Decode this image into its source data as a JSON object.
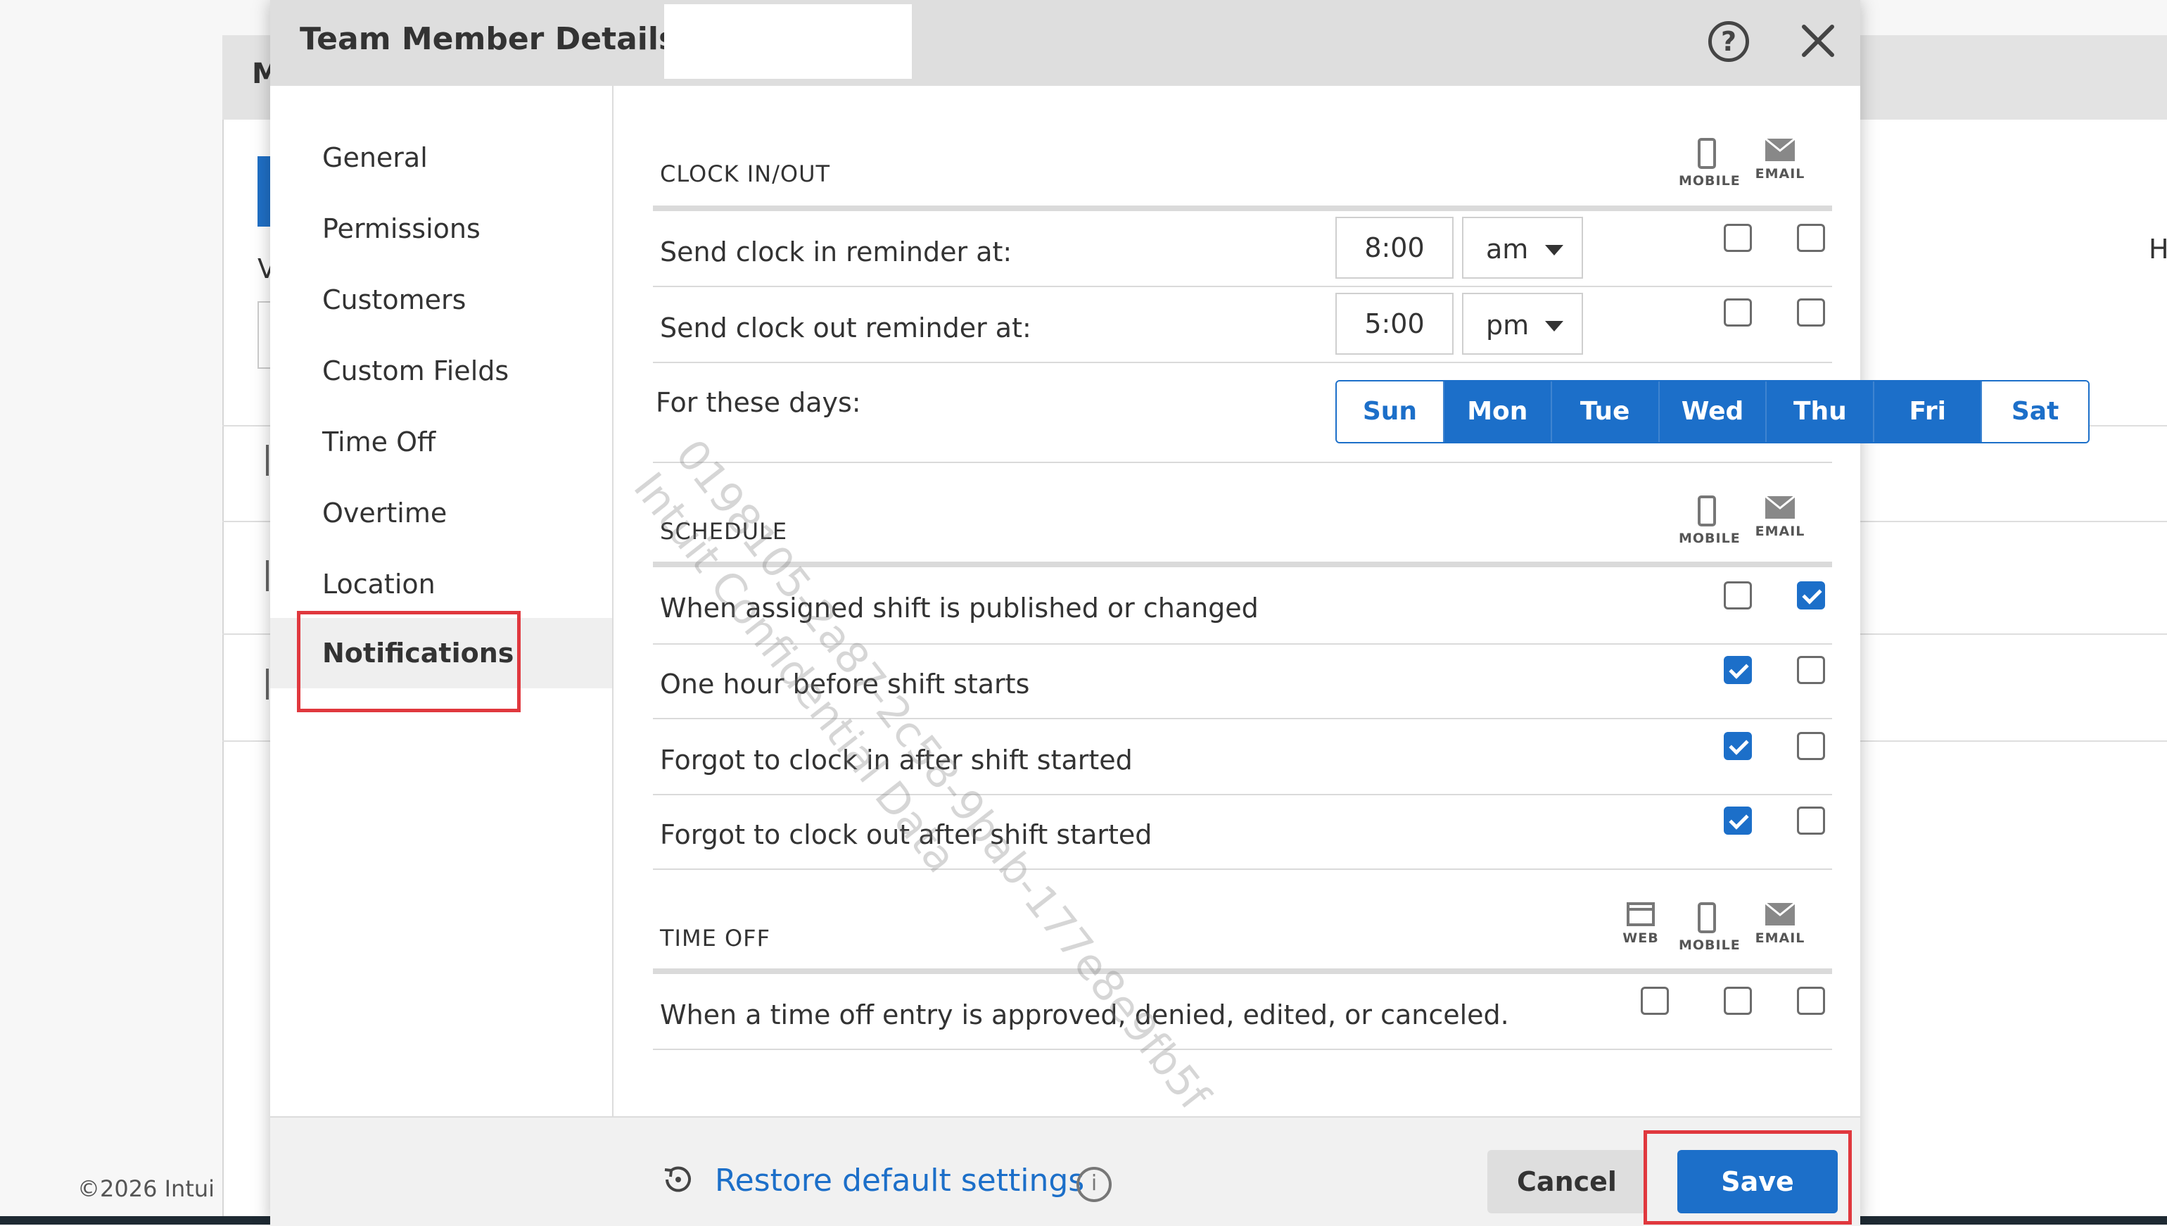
{
  "background": {
    "header_letter": "M",
    "v_letter": "V",
    "h_letter": "H",
    "copyright": "©2026 Intui"
  },
  "modal": {
    "title": "Team Member Details –",
    "help_glyph": "?",
    "sidebar": [
      {
        "label": "General"
      },
      {
        "label": "Permissions"
      },
      {
        "label": "Customers"
      },
      {
        "label": "Custom Fields"
      },
      {
        "label": "Time Off"
      },
      {
        "label": "Overtime"
      },
      {
        "label": "Location"
      },
      {
        "label": "Notifications",
        "active": true
      }
    ],
    "columns": {
      "web": "WEB",
      "mobile": "MOBILE",
      "email": "EMAIL"
    },
    "clock": {
      "title": "CLOCK IN/OUT",
      "clock_in_label": "Send clock in reminder at:",
      "clock_in_time": "8:00",
      "clock_in_ampm": "am",
      "clock_out_label": "Send clock out reminder at:",
      "clock_out_time": "5:00",
      "clock_out_ampm": "pm",
      "days_label": "For these days:",
      "days": [
        {
          "label": "Sun",
          "selected": false
        },
        {
          "label": "Mon",
          "selected": true
        },
        {
          "label": "Tue",
          "selected": true
        },
        {
          "label": "Wed",
          "selected": true
        },
        {
          "label": "Thu",
          "selected": true
        },
        {
          "label": "Fri",
          "selected": true
        },
        {
          "label": "Sat",
          "selected": false
        }
      ],
      "rows_checked": [
        {
          "mobile": false,
          "email": false
        },
        {
          "mobile": false,
          "email": false
        }
      ]
    },
    "schedule": {
      "title": "SCHEDULE",
      "rows": [
        {
          "label": "When assigned shift is published or changed",
          "mobile": false,
          "email": true
        },
        {
          "label": "One hour before shift starts",
          "mobile": true,
          "email": false
        },
        {
          "label": "Forgot to clock in after shift started",
          "mobile": true,
          "email": false
        },
        {
          "label": "Forgot to clock out after shift started",
          "mobile": true,
          "email": false
        }
      ]
    },
    "time_off": {
      "title": "TIME OFF",
      "rows": [
        {
          "label": "When a time off entry is approved, denied, edited, or canceled.",
          "web": false,
          "mobile": false,
          "email": false
        }
      ]
    },
    "watermark": {
      "line1": "0198105-2a87-2c58-9bab-177e8e9fb5f",
      "line2": "Intuit Confidential Data"
    },
    "footer": {
      "restore": "Restore default settings",
      "info_glyph": "i",
      "cancel": "Cancel",
      "save": "Save"
    }
  }
}
